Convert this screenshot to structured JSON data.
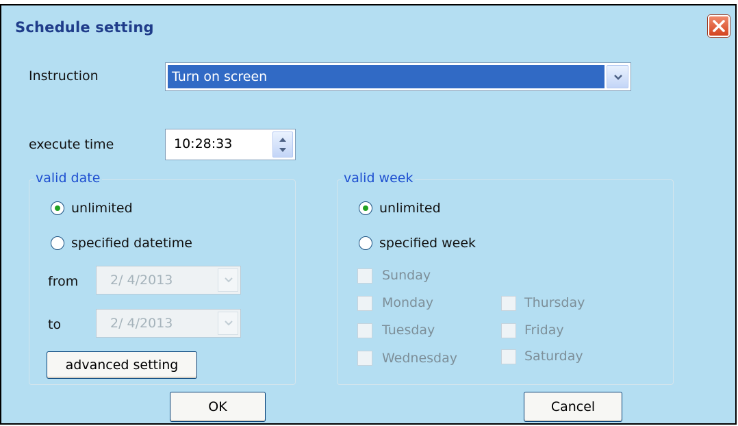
{
  "window": {
    "title": "Schedule setting",
    "close_icon": "close-icon",
    "background": "#b4def2"
  },
  "instruction": {
    "label": "Instruction",
    "selected": "Turn on screen",
    "dropdown_icon": "chevron-down-icon"
  },
  "execute_time": {
    "label": "execute time",
    "value": "10:28:33",
    "spinner_icon": "spin-up-down-icon"
  },
  "valid_date": {
    "title": "valid date",
    "option_unlimited": "unlimited",
    "option_specified": "specified datetime",
    "selected": "unlimited",
    "from_label": "from",
    "from_value": "2/ 4/2013",
    "to_label": "to",
    "to_value": "2/ 4/2013",
    "advanced_button": "advanced setting"
  },
  "valid_week": {
    "title": "valid week",
    "option_unlimited": "unlimited",
    "option_specified": "specified week",
    "selected": "unlimited",
    "days": {
      "sunday": "Sunday",
      "monday": "Monday",
      "tuesday": "Tuesday",
      "wednesday": "Wednesday",
      "thursday": "Thursday",
      "friday": "Friday",
      "saturday": "Saturday"
    }
  },
  "buttons": {
    "ok": "OK",
    "cancel": "Cancel"
  },
  "colors": {
    "group_title": "#1e4fd0",
    "selection": "#316ac5",
    "radio_dot": "#21a121",
    "close": "#d4431f"
  }
}
